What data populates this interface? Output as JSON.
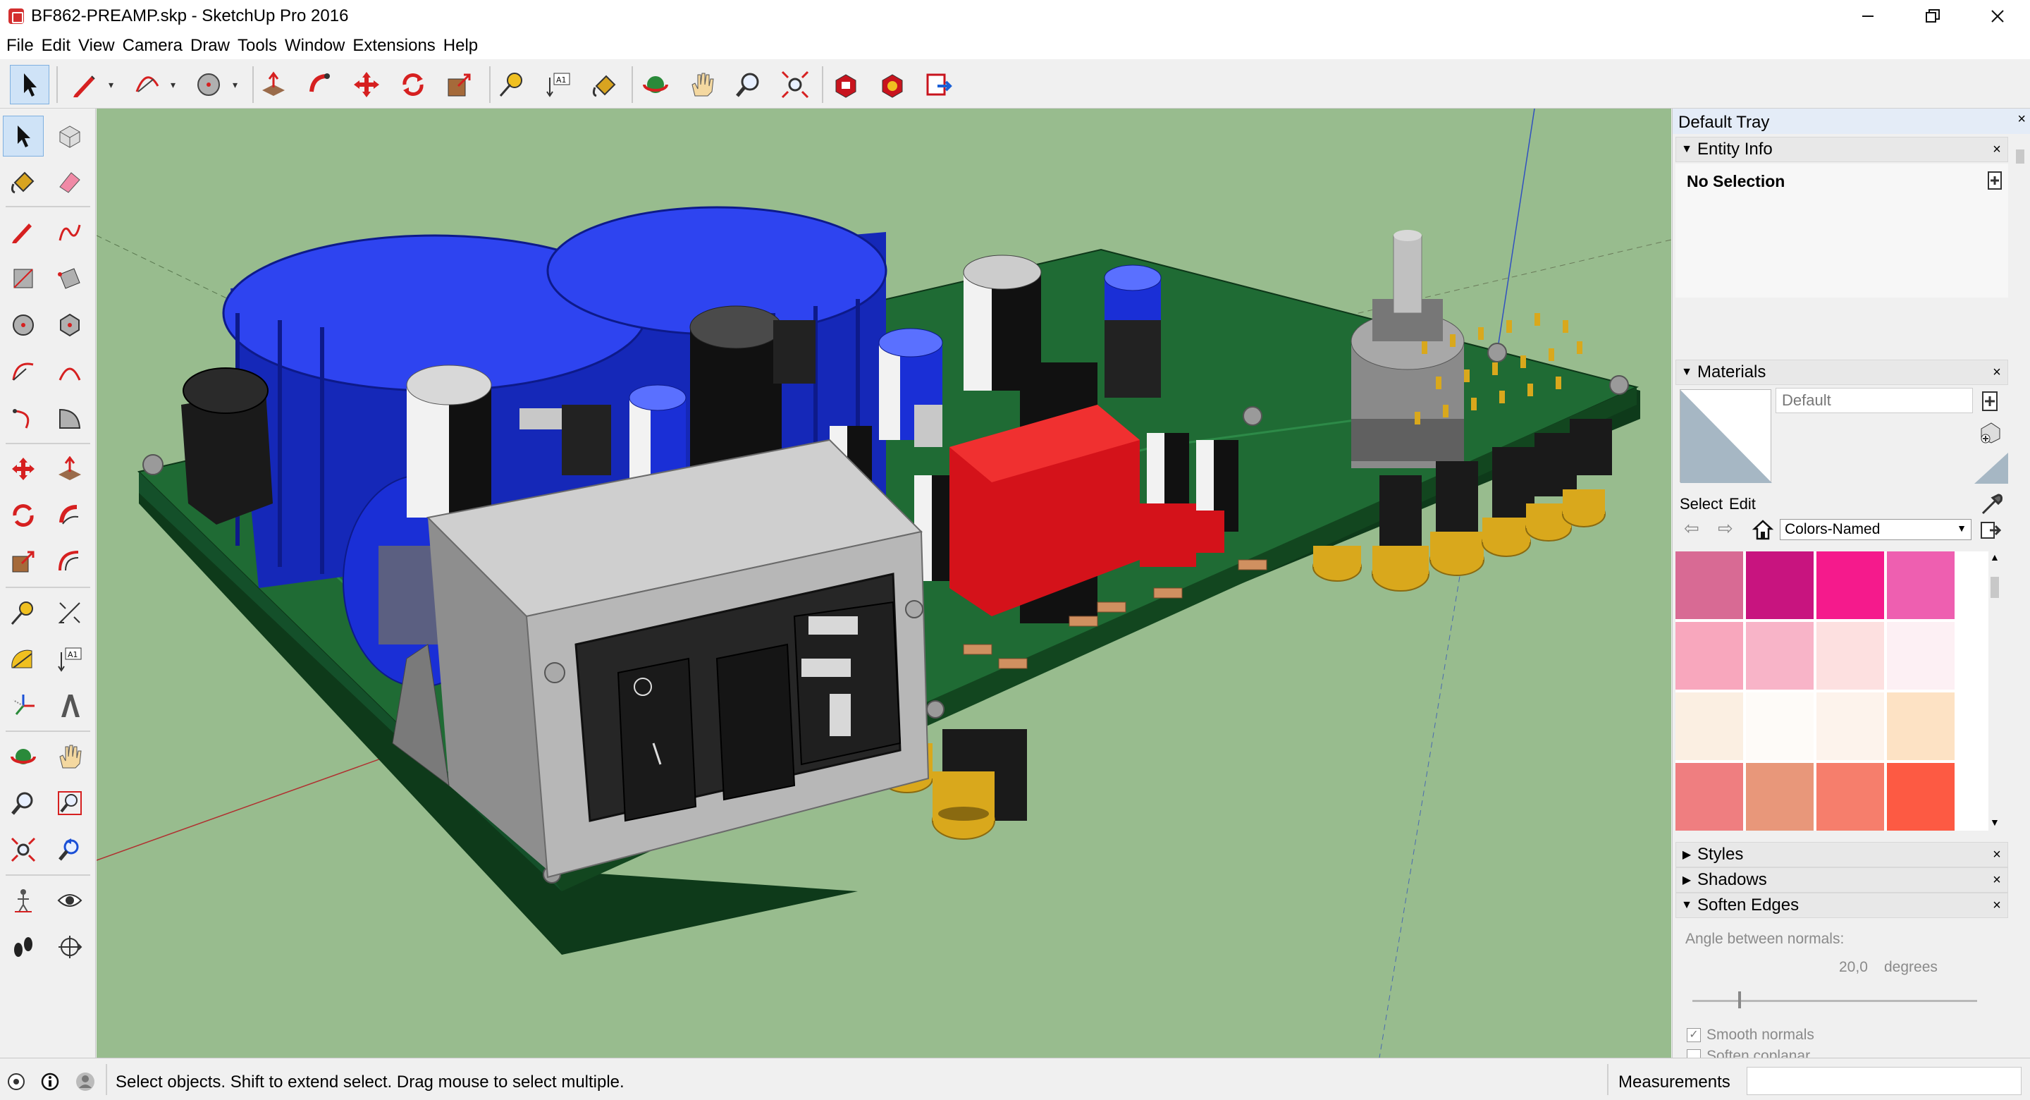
{
  "window": {
    "title": "BF862-PREAMP.skp - SketchUp Pro 2016"
  },
  "menu": [
    "File",
    "Edit",
    "View",
    "Camera",
    "Draw",
    "Tools",
    "Window",
    "Extensions",
    "Help"
  ],
  "toolbar": {
    "tools": [
      "select",
      "line",
      "arc",
      "circle",
      "push-pull",
      "follow-me",
      "move",
      "rotate",
      "scale",
      "tape-measure",
      "text",
      "paint-bucket",
      "orbit",
      "pan",
      "zoom",
      "zoom-extents",
      "3d-warehouse",
      "extension-warehouse",
      "send-to-layout"
    ]
  },
  "left_toolbar": {
    "tools": [
      "select",
      "component",
      "paint-bucket",
      "eraser",
      "line",
      "freehand",
      "rectangle",
      "rotated-rectangle",
      "circle",
      "polygon",
      "arc",
      "two-point-arc",
      "three-point-arc",
      "pie",
      "move",
      "push-pull",
      "rotate",
      "follow-me",
      "scale",
      "offset",
      "tape-measure",
      "dimension",
      "protractor",
      "text",
      "axes",
      "3d-text",
      "orbit",
      "pan",
      "zoom",
      "zoom-window",
      "zoom-extents",
      "previous-view",
      "position-camera",
      "look-around",
      "walk",
      "section-plane"
    ]
  },
  "tray": {
    "title": "Default Tray",
    "entity_info": {
      "title": "Entity Info",
      "selection": "No Selection"
    },
    "materials": {
      "title": "Materials",
      "material_name": "Default",
      "tabs": [
        "Select",
        "Edit"
      ],
      "library": "Colors-Named",
      "swatch_colors": [
        "#d86a94",
        "#c8147f",
        "#f51a8c",
        "#ee5fb0",
        "#f8a7bd",
        "#f8b4c8",
        "#fde0e0",
        "#fdf0f4",
        "#fbefe2",
        "#fefbf8",
        "#fdf3ec",
        "#fde2c4",
        "#ef7e80",
        "#e8977a",
        "#f67e6c",
        "#fd5a43"
      ]
    },
    "styles": {
      "title": "Styles"
    },
    "shadows": {
      "title": "Shadows"
    },
    "soften_edges": {
      "title": "Soften Edges",
      "angle_label": "Angle between normals:",
      "angle_value": "20,0",
      "angle_unit": "degrees",
      "slider_fraction": 0.16,
      "smooth_normals_label": "Smooth normals",
      "smooth_normals_checked": true,
      "soften_coplanar_label": "Soften coplanar",
      "soften_coplanar_checked": false
    }
  },
  "status": {
    "hint": "Select objects. Shift to extend select. Drag mouse to select multiple.",
    "measurements_label": "Measurements"
  },
  "colors": {
    "viewport_background": "#98bc8e",
    "pcb_green": "#1f6b34",
    "heatsink_blue": "#1a2fd6",
    "relay_red": "#e0141a",
    "connector_gold": "#d9a81c",
    "iec_housing_gray": "#b7b7b7"
  }
}
